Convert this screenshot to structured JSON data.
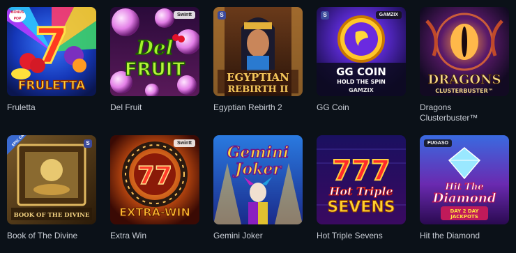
{
  "games": [
    {
      "title": "Fruletta",
      "art_text": "FRULETTA",
      "bonus_label": "BONUS POP"
    },
    {
      "title": "Del Fruit",
      "art_text_1": "Del",
      "art_text_2": "FRUIT",
      "provider": "Swintt"
    },
    {
      "title": "Egyptian Rebirth 2",
      "art_text_1": "EGYPTIAN",
      "art_text_2": "REBIRTH II"
    },
    {
      "title": "GG Coin",
      "art_text_1": "GG COIN",
      "art_text_2": "HOLD THE SPIN",
      "art_text_3": "GAMZIX",
      "provider": "GAMZIX"
    },
    {
      "title": "Dragons\nClusterbuster™",
      "art_text_1": "DRAGONS",
      "art_text_2": "CLUSTERBUSTER™"
    },
    {
      "title": "Book of The Divine",
      "art_text": "BOOK OF THE DIVINE",
      "corner_label": "EPIC CASE"
    },
    {
      "title": "Extra Win",
      "art_text_1": "77",
      "art_text_2": "EXTRA-WIN",
      "provider": "Swintt"
    },
    {
      "title": "Gemini Joker",
      "art_text_1": "Gemini",
      "art_text_2": "Joker"
    },
    {
      "title": "Hot Triple Sevens",
      "art_text_1": "777",
      "art_text_2": "Hot Triple",
      "art_text_3": "SEVENS"
    },
    {
      "title": "Hit the Diamond",
      "art_text_1": "Hit The",
      "art_text_2": "Diamond",
      "art_text_3": "DAY 2 DAY",
      "art_text_4": "JACKPOTS",
      "provider": "FUGASO"
    }
  ],
  "colors": {
    "background": "#0b1118",
    "title_text": "#c9ced6"
  }
}
